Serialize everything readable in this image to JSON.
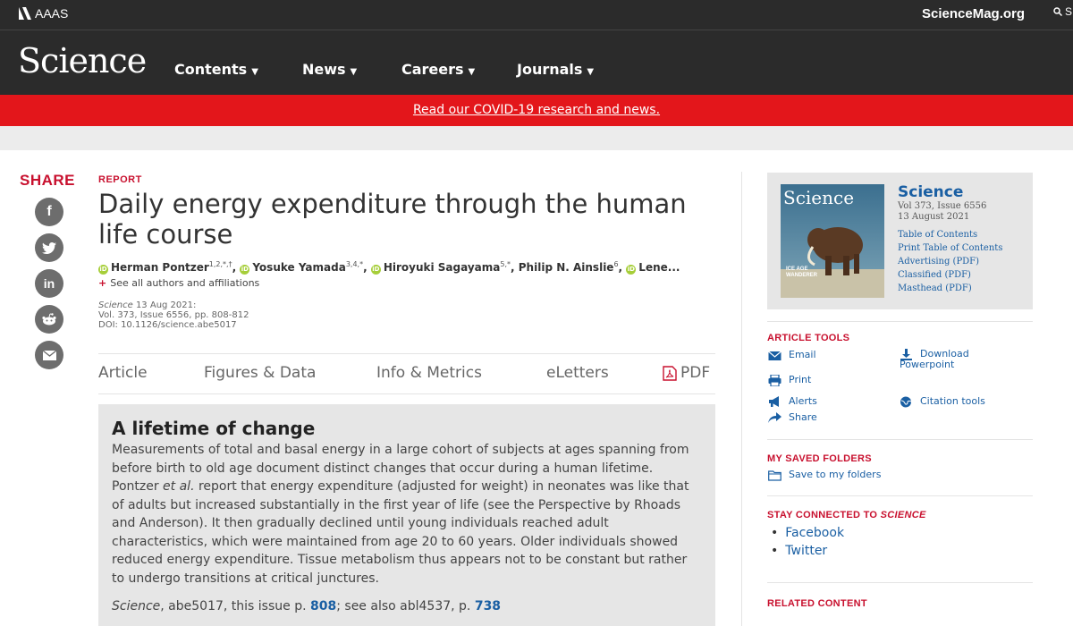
{
  "topbar": {
    "aaas_label": "AAAS",
    "site_link": "ScienceMag.org",
    "search_label": "S"
  },
  "nav": {
    "brand": "Science",
    "items": [
      {
        "label": "Contents"
      },
      {
        "label": "News"
      },
      {
        "label": "Careers"
      },
      {
        "label": "Journals"
      }
    ]
  },
  "banner": {
    "text": "Read our COVID-19 research and news."
  },
  "share": {
    "title": "SHARE",
    "buttons": [
      {
        "icon": "facebook-icon",
        "glyph": "f"
      },
      {
        "icon": "twitter-icon",
        "glyph": "t"
      },
      {
        "icon": "linkedin-icon",
        "glyph": "in"
      },
      {
        "icon": "reddit-icon",
        "glyph": ""
      },
      {
        "icon": "email-icon",
        "glyph": ""
      }
    ]
  },
  "article": {
    "type_label": "REPORT",
    "title": "Daily energy expenditure through the human life course",
    "authors": [
      {
        "name": "Herman Pontzer",
        "sup": "1,2,*,†"
      },
      {
        "name": "Yosuke Yamada",
        "sup": "3,4,*"
      },
      {
        "name": "Hiroyuki Sagayama",
        "sup": "5,*"
      },
      {
        "name": "Philip N. Ainslie",
        "sup": "6"
      },
      {
        "name": "Lene...",
        "sup": ""
      }
    ],
    "see_all": "See all authors and affiliations",
    "journal_italic": "Science",
    "pub_date": " 13 Aug 2021:",
    "volume_line": "Vol. 373, Issue 6556, pp. 808-812",
    "doi_line": "DOI: 10.1126/science.abe5017"
  },
  "tabs": [
    {
      "label": "Article"
    },
    {
      "label": "Figures & Data"
    },
    {
      "label": "Info & Metrics"
    },
    {
      "label": "eLetters"
    },
    {
      "label": "PDF"
    }
  ],
  "summary": {
    "heading": "A lifetime of change",
    "text_before": "Measurements of total and basal energy in a large cohort of subjects at ages spanning from before birth to old age document distinct changes that occur during a human lifetime. Pontzer ",
    "text_italic": "et al.",
    "text_after": " report that energy expenditure (adjusted for weight) in neonates was like that of adults but increased substantially in the first year of life (see the Perspective by Rhoads and Anderson). It then gradually declined until young individuals reached adult characteristics, which were maintained from age 20 to 60 years. Older individuals showed reduced energy expenditure. Tissue metabolism thus appears not to be constant but rather to undergo transitions at critical junctures.",
    "ref_journal": "Science",
    "ref_part1": ", abe5017, this issue p. ",
    "ref_page1": "808",
    "ref_part2": "; see also abl4537, p. ",
    "ref_page2": "738"
  },
  "sidebar": {
    "issue": {
      "journal": "Science",
      "volume": "Vol 373, Issue 6556",
      "date": "13 August 2021",
      "links": [
        "Table of Contents",
        "Print Table of Contents",
        "Advertising (PDF)",
        "Classified (PDF)",
        "Masthead (PDF)"
      ],
      "cover_title": "Science",
      "cover_caption_line1": "ICE AGE",
      "cover_caption_line2": "WANDERER"
    },
    "tools_heading": "ARTICLE TOOLS",
    "tools": {
      "email": "Email",
      "download_line1": "Download",
      "download_line2": "Powerpoint",
      "print": "Print",
      "alerts": "Alerts",
      "citation": "Citation tools",
      "share": "Share"
    },
    "saved_heading": "MY SAVED FOLDERS",
    "save_label": "Save to my folders",
    "stay_heading_prefix": "STAY CONNECTED TO ",
    "stay_heading_journal": "SCIENCE",
    "stay_links": [
      "Facebook",
      "Twitter"
    ],
    "related_heading": "RELATED CONTENT"
  },
  "colors": {
    "accent_red": "#c8102e",
    "banner_red": "#e3161b",
    "link_blue": "#1a5fa3",
    "header_dark": "#2b2b2b",
    "orcid_green": "#a6ce39"
  }
}
